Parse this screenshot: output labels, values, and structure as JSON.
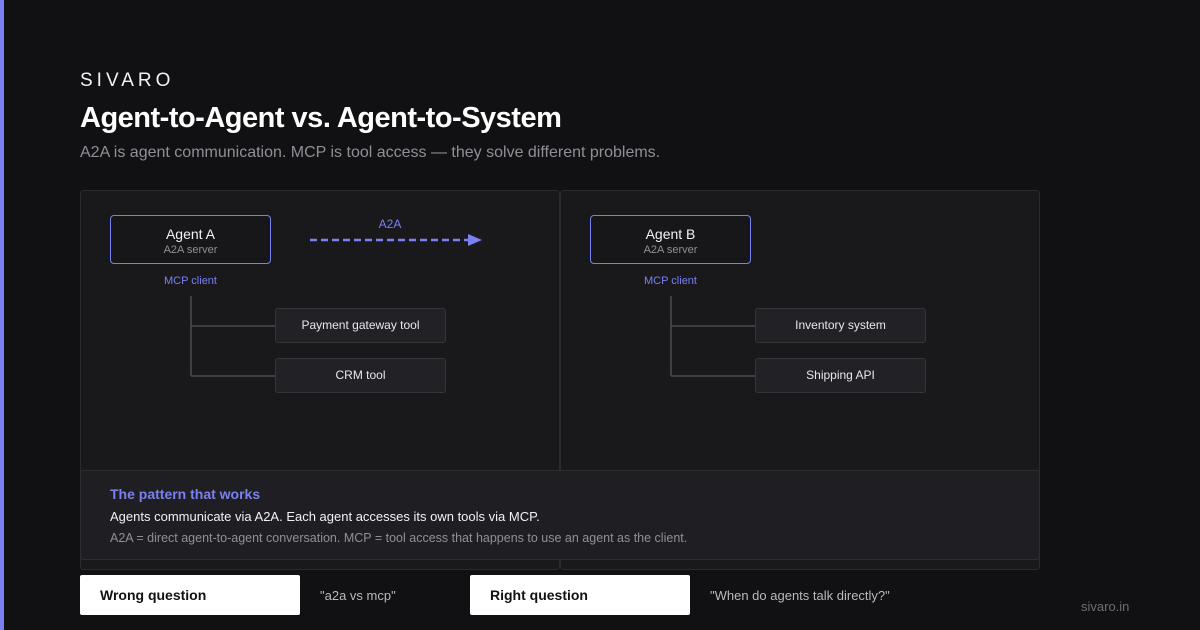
{
  "brand": "SIVARO",
  "title": "Agent-to-Agent vs. Agent-to-System",
  "subtitle": "A2A is agent communication. MCP is tool access — they solve different problems.",
  "connection_label": "A2A",
  "agents": [
    {
      "name": "Agent A",
      "role": "A2A server",
      "client_label": "MCP client",
      "tools": [
        "Payment gateway tool",
        "CRM tool"
      ]
    },
    {
      "name": "Agent B",
      "role": "A2A server",
      "client_label": "MCP client",
      "tools": [
        "Inventory system",
        "Shipping API"
      ]
    }
  ],
  "pattern": {
    "title": "The pattern that works",
    "main": "Agents communicate via A2A. Each agent accesses its own tools via MCP.",
    "note": "A2A = direct agent-to-agent conversation. MCP = tool access that happens to use an agent as the client."
  },
  "questions": {
    "wrong_label": "Wrong question",
    "wrong_text": "\"a2a vs mcp\"",
    "right_label": "Right question",
    "right_text": "\"When do agents talk directly?\""
  },
  "footer": "sivaro.in",
  "colors": {
    "accent": "#7b80f0",
    "background": "#111113",
    "panel": "#19191c"
  }
}
